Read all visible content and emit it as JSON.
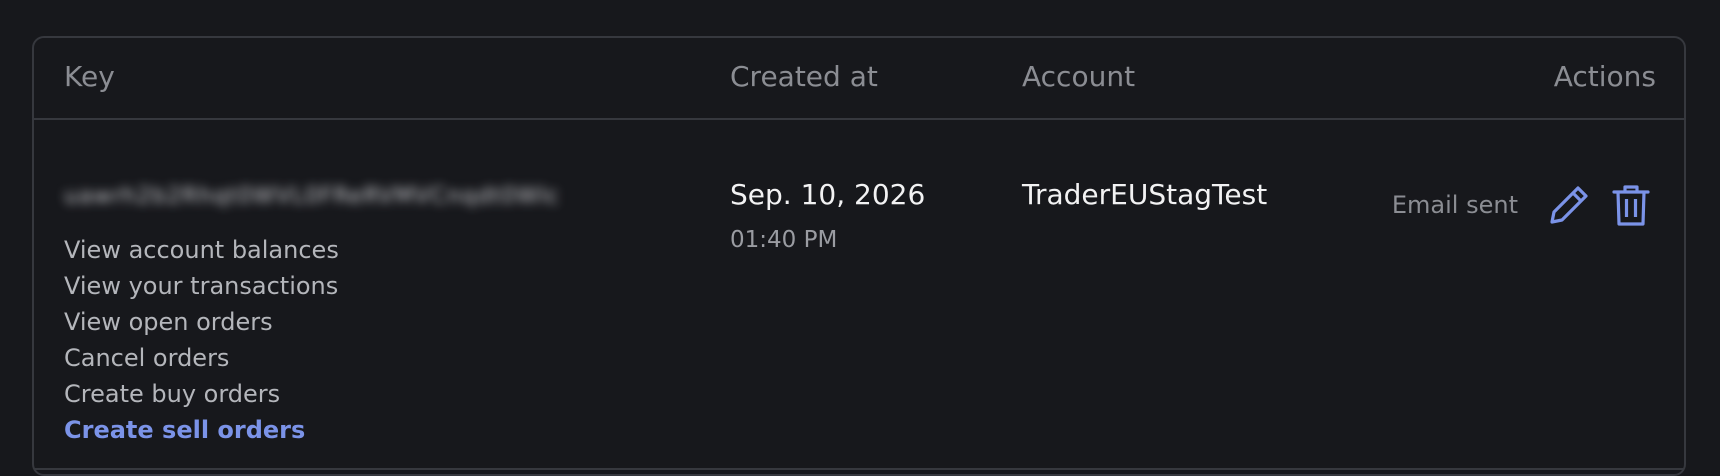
{
  "table": {
    "columns": {
      "key": "Key",
      "created_at": "Created at",
      "account": "Account",
      "actions": "Actions"
    },
    "rows": [
      {
        "key_masked": "uawrh2b2Rhqt0WVL0FReRVMVCnqdt0WIc",
        "permissions": [
          "View account balances",
          "View your transactions",
          "View open orders",
          "Cancel orders",
          "Create buy orders",
          "Create sell orders"
        ],
        "created_date": "Sep. 10, 2026",
        "created_time": "01:40 PM",
        "account": "TraderEUStagTest",
        "status": "Email sent"
      }
    ]
  },
  "colors": {
    "background": "#17181c",
    "border": "#36383e",
    "accent": "#7b93e8",
    "muted_text": "#8b8d93"
  },
  "icons": {
    "edit": "pencil-icon",
    "delete": "trash-icon"
  }
}
